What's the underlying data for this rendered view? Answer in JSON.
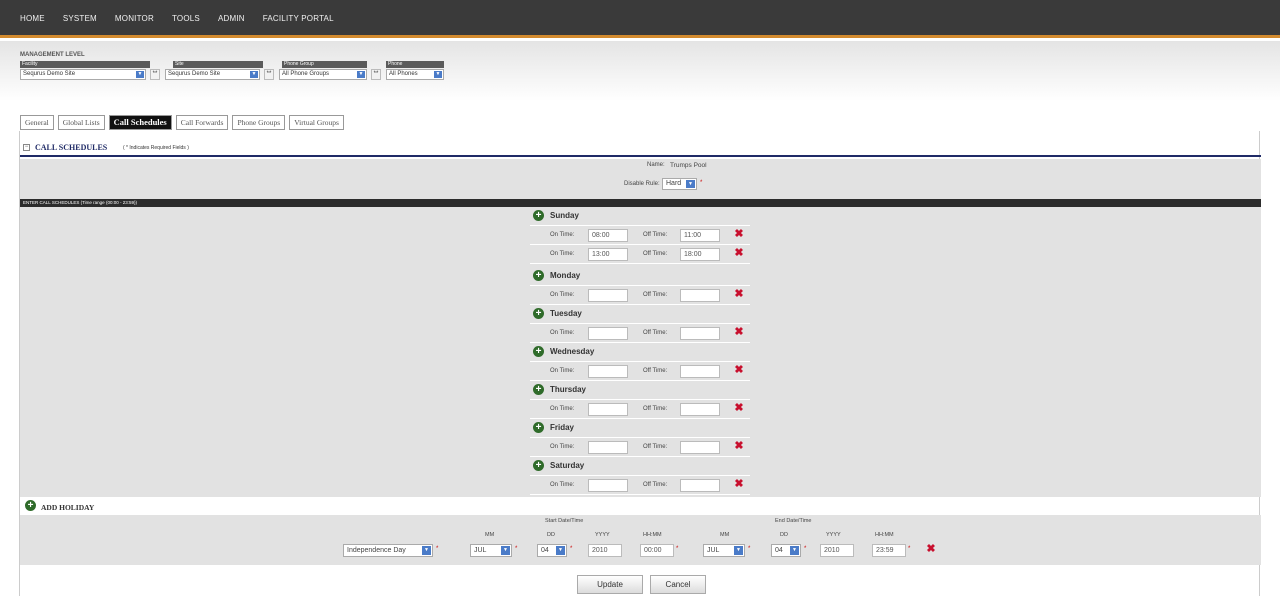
{
  "nav": {
    "items": [
      "HOME",
      "SYSTEM",
      "MONITOR",
      "TOOLS",
      "ADMIN",
      "FACILITY PORTAL"
    ]
  },
  "management": {
    "title": "MANAGEMENT LEVEL",
    "headers": {
      "facility": "Facility",
      "site": "Site",
      "phone_group": "Phone Group",
      "phone": "Phone"
    },
    "facility_value": "Sequrus Demo Site",
    "site_value": "Sequrus Demo Site",
    "phone_group_value": "All Phone Groups",
    "phone_value": "All Phones",
    "star": "**"
  },
  "tabs": [
    {
      "label": "General",
      "active": false
    },
    {
      "label": "Global Lists",
      "active": false
    },
    {
      "label": "Call Schedules",
      "active": true
    },
    {
      "label": "Call Forwards",
      "active": false
    },
    {
      "label": "Phone Groups",
      "active": false
    },
    {
      "label": "Virtual Groups",
      "active": false
    }
  ],
  "call_schedules": {
    "title": "CALL SCHEDULES",
    "required_note": "( * Indicates Required Fields )",
    "name_label": "Name:",
    "name_value": "Trumps Pool",
    "disable_rule_label": "Disable Rule:",
    "disable_rule_value": "Hard",
    "enter_bar": "ENTER CALL SCHEDULES (Time range (00:00 - 23:59))",
    "on_time_label": "On Time:",
    "off_time_label": "Off Time:",
    "days": [
      {
        "name": "Sunday",
        "rows": [
          {
            "on": "08:00",
            "off": "11:00"
          },
          {
            "on": "13:00",
            "off": "18:00"
          }
        ]
      },
      {
        "name": "Monday",
        "rows": [
          {
            "on": "",
            "off": ""
          }
        ]
      },
      {
        "name": "Tuesday",
        "rows": [
          {
            "on": "",
            "off": ""
          }
        ]
      },
      {
        "name": "Wednesday",
        "rows": [
          {
            "on": "",
            "off": ""
          }
        ]
      },
      {
        "name": "Thursday",
        "rows": [
          {
            "on": "",
            "off": ""
          }
        ]
      },
      {
        "name": "Friday",
        "rows": [
          {
            "on": "",
            "off": ""
          }
        ]
      },
      {
        "name": "Saturday",
        "rows": [
          {
            "on": "",
            "off": ""
          }
        ]
      }
    ]
  },
  "holiday": {
    "title": "ADD HOLIDAY",
    "start_label": "Start Date/Time",
    "end_label": "End Date/Time",
    "col_mm": "MM",
    "col_dd": "DD",
    "col_yyyy": "YYYY",
    "col_hhmm": "HH:MM",
    "name": "Independence Day",
    "start": {
      "mm": "JUL",
      "dd": "04",
      "yyyy": "2010",
      "hhmm": "00:00"
    },
    "end": {
      "mm": "JUL",
      "dd": "04",
      "yyyy": "2010",
      "hhmm": "23:59"
    }
  },
  "buttons": {
    "update": "Update",
    "cancel": "Cancel"
  },
  "colors": {
    "nav_bg": "#3a3a3a",
    "nav_accent": "#d28a2e",
    "header_blue": "#1f2a66",
    "delete_red": "#c8102e",
    "plus_green": "#2f6b2a"
  }
}
